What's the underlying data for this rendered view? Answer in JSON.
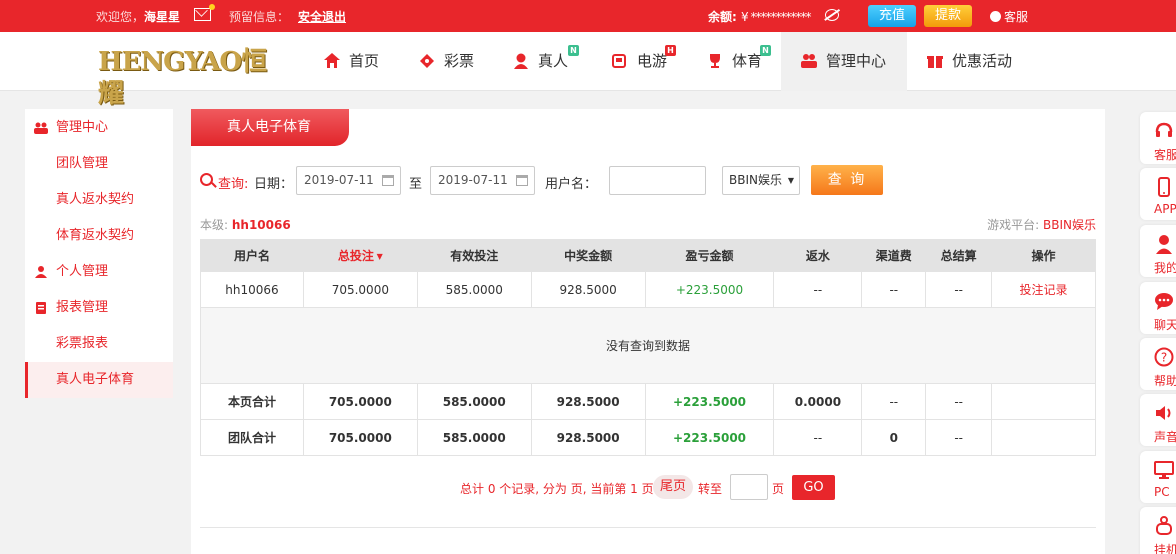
{
  "topbar": {
    "welcome": "欢迎您，",
    "username": "海星星",
    "reserve_info": "预留信息：",
    "logout": "安全退出",
    "balance_label": "余额:",
    "balance_value": "¥ ************",
    "recharge": "充值",
    "withdraw": "提款",
    "service": "客服"
  },
  "logo": "HENGYAO恒耀",
  "nav": {
    "items": [
      {
        "label": "首页",
        "icon": "home-icon"
      },
      {
        "label": "彩票",
        "icon": "ticket-icon"
      },
      {
        "label": "真人",
        "icon": "dealer-icon",
        "badge": "N"
      },
      {
        "label": "电游",
        "icon": "slot-icon",
        "badge": "H"
      },
      {
        "label": "体育",
        "icon": "trophy-icon",
        "badge": "N"
      },
      {
        "label": "管理中心",
        "icon": "people-icon",
        "active": true
      },
      {
        "label": "优惠活动",
        "icon": "gift-icon"
      }
    ]
  },
  "sidebar": {
    "items": [
      {
        "label": "管理中心",
        "type": "group",
        "icon": "people-icon"
      },
      {
        "label": "团队管理",
        "type": "sub"
      },
      {
        "label": "真人返水契约",
        "type": "sub"
      },
      {
        "label": "体育返水契约",
        "type": "sub"
      },
      {
        "label": "个人管理",
        "type": "group",
        "icon": "person-icon"
      },
      {
        "label": "报表管理",
        "type": "group",
        "icon": "report-icon"
      },
      {
        "label": "彩票报表",
        "type": "sub"
      },
      {
        "label": "真人电子体育",
        "type": "sub",
        "active": true
      }
    ]
  },
  "main": {
    "tab": "真人电子体育",
    "search": {
      "query_label": "查询:",
      "date_label": "日期：",
      "date_from": "2019-07-11",
      "to": "至",
      "date_to": "2019-07-11",
      "user_label": "用户名：",
      "user_value": "",
      "platform_selected": "BBIN娱乐",
      "query_button": "查 询"
    },
    "level_label": "本级:",
    "level_user": "hh10066",
    "platform_label": "游戏平台:",
    "platform_value": "BBIN娱乐",
    "table": {
      "headers": [
        "用户名",
        "总投注",
        "有效投注",
        "中奖金额",
        "盈亏金额",
        "返水",
        "渠道费",
        "总结算",
        "操作"
      ],
      "row": [
        "hh10066",
        "705.0000",
        "585.0000",
        "928.5000",
        "+223.5000",
        "--",
        "--",
        "--",
        "投注记录"
      ],
      "empty": "没有查询到数据",
      "page_total": [
        "本页合计",
        "705.0000",
        "585.0000",
        "928.5000",
        "+223.5000",
        "0.0000",
        "--",
        "--",
        ""
      ],
      "team_total": [
        "团队合计",
        "705.0000",
        "585.0000",
        "928.5000",
        "+223.5000",
        "--",
        "0",
        "--",
        ""
      ]
    },
    "pager": {
      "summary": "总计 0 个记录, 分为 页, 当前第 1 页",
      "last": "尾页",
      "goto": "转至",
      "page_unit": "页",
      "go": "GO"
    }
  },
  "float_bar": [
    {
      "label": "客服",
      "icon": "headset-icon"
    },
    {
      "label": "APP",
      "icon": "phone-icon"
    },
    {
      "label": "我的",
      "icon": "user-icon"
    },
    {
      "label": "聊天",
      "icon": "chat-icon"
    },
    {
      "label": "帮助",
      "icon": "help-icon"
    },
    {
      "label": "声音",
      "icon": "speaker-icon"
    },
    {
      "label": "PC",
      "icon": "monitor-icon"
    },
    {
      "label": "挂机",
      "icon": "robot-icon"
    }
  ],
  "colors": {
    "brand_red": "#e8262b",
    "gain_green": "#2ba03a",
    "recharge_blue": "#16a2e8",
    "withdraw_orange": "#f39a0a"
  }
}
